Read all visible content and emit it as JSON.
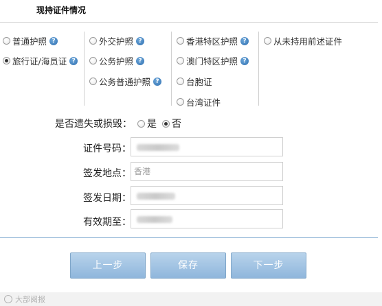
{
  "header": {
    "title": "现持证件情况"
  },
  "doc_types": {
    "col1": [
      {
        "label": "普通护照",
        "help": true,
        "checked": false
      },
      {
        "label": "旅行证/海员证",
        "help": true,
        "checked": true
      }
    ],
    "col2": [
      {
        "label": "外交护照",
        "help": true,
        "checked": false
      },
      {
        "label": "公务护照",
        "help": true,
        "checked": false
      },
      {
        "label": "公务普通护照",
        "help": true,
        "checked": false
      }
    ],
    "col3": [
      {
        "label": "香港特区护照",
        "help": true,
        "checked": false
      },
      {
        "label": "澳门特区护照",
        "help": true,
        "checked": false
      },
      {
        "label": "台胞证",
        "help": false,
        "checked": false
      },
      {
        "label": "台湾证件",
        "help": false,
        "checked": false
      }
    ],
    "col4": [
      {
        "label": "从未持用前述证件",
        "help": false,
        "checked": false
      }
    ],
    "help_glyph": "?"
  },
  "lost": {
    "label": "是否遗失或损毁：",
    "yes": "是",
    "no": "否",
    "selected": "no"
  },
  "form": {
    "id_number": {
      "label": "证件号码：",
      "value": ""
    },
    "issue_place": {
      "label": "签发地点：",
      "value": "香港"
    },
    "issue_date": {
      "label": "签发日期：",
      "value": ""
    },
    "valid_until": {
      "label": "有效期至：",
      "value": ""
    }
  },
  "buttons": {
    "prev": "上一步",
    "save": "保存",
    "next": "下一步"
  },
  "watermark": {
    "text": "大部阅报"
  },
  "colors": {
    "button_top": "#b8d3eb",
    "button_bottom": "#8fb6dc",
    "help_icon": "#2f6fb0"
  }
}
